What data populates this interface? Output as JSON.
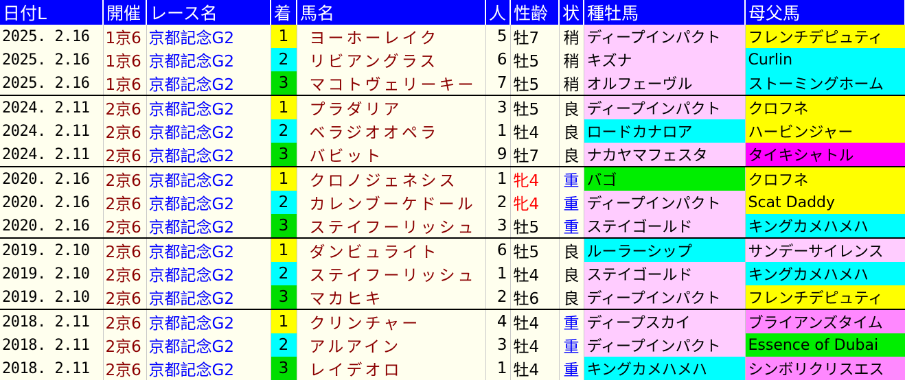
{
  "headers": {
    "date": "日付L",
    "kai": "開催",
    "race": "レース名",
    "rank": "着",
    "horse": "馬名",
    "pop": "人",
    "sexage": "性齢",
    "cond": "状",
    "sire": "種牡馬",
    "dam": "母父馬"
  },
  "colors": {
    "header_bg": "#0000ff",
    "rank_1": "#ffff00",
    "rank_2": "#00ffff",
    "rank_3": "#00dd00",
    "sire_pink": "#ffccff",
    "cyan": "#00ffff",
    "green": "#00ee00",
    "yellow": "#ffff00",
    "magenta": "#ff00ff",
    "violet": "#ff88ff",
    "light_pink": "#ffccff"
  },
  "rows": [
    {
      "date": "2025. 2.16",
      "kai": "1京6",
      "race": "京都記念G2",
      "rank": "1",
      "horse": "ヨーホーレイク",
      "pop": "5",
      "sexage": "牡7",
      "cond": "稍",
      "sire": "ディープインパクト",
      "sire_bg": "#ffccff",
      "dam": "フレンチデピュティ",
      "dam_bg": "#ffff00",
      "group_start": false,
      "female": false
    },
    {
      "date": "2025. 2.16",
      "kai": "1京6",
      "race": "京都記念G2",
      "rank": "2",
      "horse": "リビアングラス",
      "pop": "6",
      "sexage": "牡5",
      "cond": "稍",
      "sire": "キズナ",
      "sire_bg": "#ffccff",
      "dam": "Curlin",
      "dam_bg": "#00ffff",
      "group_start": false,
      "female": false
    },
    {
      "date": "2025. 2.16",
      "kai": "1京6",
      "race": "京都記念G2",
      "rank": "3",
      "horse": "マコトヴェリーキー",
      "pop": "7",
      "sexage": "牡5",
      "cond": "稍",
      "sire": "オルフェーヴル",
      "sire_bg": "#ffccff",
      "dam": "ストーミングホーム",
      "dam_bg": "#00ffff",
      "group_start": false,
      "female": false
    },
    {
      "date": "2024. 2.11",
      "kai": "2京6",
      "race": "京都記念G2",
      "rank": "1",
      "horse": "プラダリア",
      "pop": "3",
      "sexage": "牡5",
      "cond": "良",
      "sire": "ディープインパクト",
      "sire_bg": "#ffccff",
      "dam": "クロフネ",
      "dam_bg": "#ffff00",
      "group_start": true,
      "female": false
    },
    {
      "date": "2024. 2.11",
      "kai": "2京6",
      "race": "京都記念G2",
      "rank": "2",
      "horse": "ベラジオオペラ",
      "pop": "1",
      "sexage": "牡4",
      "cond": "良",
      "sire": "ロードカナロア",
      "sire_bg": "#00ffff",
      "dam": "ハービンジャー",
      "dam_bg": "#ffff00",
      "group_start": false,
      "female": false
    },
    {
      "date": "2024. 2.11",
      "kai": "2京6",
      "race": "京都記念G2",
      "rank": "3",
      "horse": "バビット",
      "pop": "9",
      "sexage": "牡7",
      "cond": "良",
      "sire": "ナカヤマフェスタ",
      "sire_bg": "#ffccff",
      "dam": "タイキシャトル",
      "dam_bg": "#ff00ff",
      "group_start": false,
      "female": false
    },
    {
      "date": "2020. 2.16",
      "kai": "2京6",
      "race": "京都記念G2",
      "rank": "1",
      "horse": "クロノジェネシス",
      "pop": "1",
      "sexage": "牝4",
      "cond": "重",
      "sire": "バゴ",
      "sire_bg": "#00ee00",
      "dam": "クロフネ",
      "dam_bg": "#ffff00",
      "group_start": true,
      "female": true
    },
    {
      "date": "2020. 2.16",
      "kai": "2京6",
      "race": "京都記念G2",
      "rank": "2",
      "horse": "カレンブーケドール",
      "pop": "2",
      "sexage": "牝4",
      "cond": "重",
      "sire": "ディープインパクト",
      "sire_bg": "#ffccff",
      "dam": "Scat Daddy",
      "dam_bg": "#ffff00",
      "group_start": false,
      "female": true
    },
    {
      "date": "2020. 2.16",
      "kai": "2京6",
      "race": "京都記念G2",
      "rank": "3",
      "horse": "ステイフーリッシュ",
      "pop": "3",
      "sexage": "牡5",
      "cond": "重",
      "sire": "ステイゴールド",
      "sire_bg": "#ffccff",
      "dam": "キングカメハメハ",
      "dam_bg": "#00ffff",
      "group_start": false,
      "female": false
    },
    {
      "date": "2019. 2.10",
      "kai": "2京6",
      "race": "京都記念G2",
      "rank": "1",
      "horse": "ダンビュライト",
      "pop": "6",
      "sexage": "牡5",
      "cond": "良",
      "sire": "ルーラーシップ",
      "sire_bg": "#00ffff",
      "dam": "サンデーサイレンス",
      "dam_bg": "#ffccff",
      "group_start": true,
      "female": false
    },
    {
      "date": "2019. 2.10",
      "kai": "2京6",
      "race": "京都記念G2",
      "rank": "2",
      "horse": "ステイフーリッシュ",
      "pop": "1",
      "sexage": "牡4",
      "cond": "良",
      "sire": "ステイゴールド",
      "sire_bg": "#ffccff",
      "dam": "キングカメハメハ",
      "dam_bg": "#00ffff",
      "group_start": false,
      "female": false
    },
    {
      "date": "2019. 2.10",
      "kai": "2京6",
      "race": "京都記念G2",
      "rank": "3",
      "horse": "マカヒキ",
      "pop": "2",
      "sexage": "牡6",
      "cond": "良",
      "sire": "ディープインパクト",
      "sire_bg": "#ffccff",
      "dam": "フレンチデピュティ",
      "dam_bg": "#ffff00",
      "group_start": false,
      "female": false
    },
    {
      "date": "2018. 2.11",
      "kai": "2京6",
      "race": "京都記念G2",
      "rank": "1",
      "horse": "クリンチャー",
      "pop": "4",
      "sexage": "牡4",
      "cond": "重",
      "sire": "ディープスカイ",
      "sire_bg": "#ffccff",
      "dam": "ブライアンズタイム",
      "dam_bg": "#ff88ff",
      "group_start": true,
      "female": false
    },
    {
      "date": "2018. 2.11",
      "kai": "2京6",
      "race": "京都記念G2",
      "rank": "2",
      "horse": "アルアイン",
      "pop": "3",
      "sexage": "牡4",
      "cond": "重",
      "sire": "ディープインパクト",
      "sire_bg": "#ffccff",
      "dam": "Essence of Dubai",
      "dam_bg": "#00ee00",
      "group_start": false,
      "female": false
    },
    {
      "date": "2018. 2.11",
      "kai": "2京6",
      "race": "京都記念G2",
      "rank": "3",
      "horse": "レイデオロ",
      "pop": "1",
      "sexage": "牡4",
      "cond": "重",
      "sire": "キングカメハメハ",
      "sire_bg": "#00ffff",
      "dam": "シンボリクリスエス",
      "dam_bg": "#ff88ff",
      "group_start": false,
      "female": false
    }
  ]
}
